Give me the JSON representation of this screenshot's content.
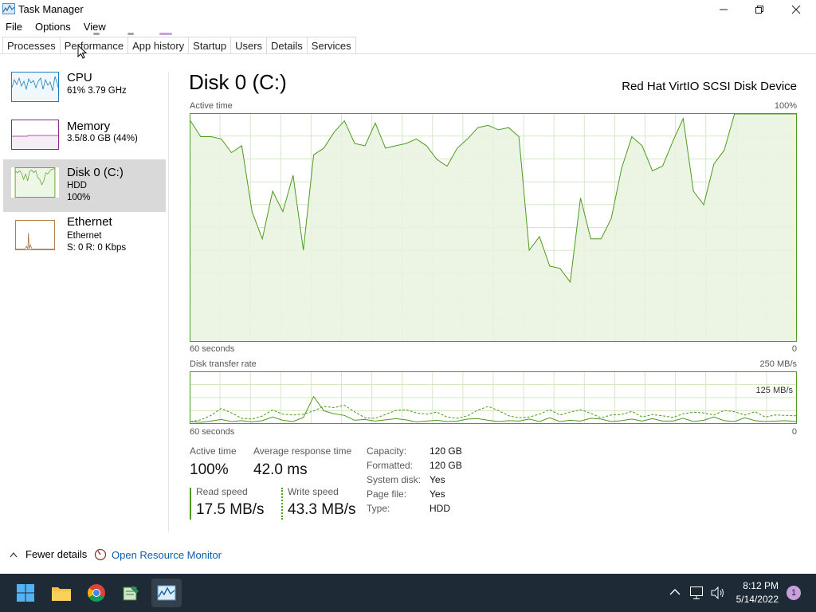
{
  "window": {
    "title": "Task Manager"
  },
  "menu": [
    "File",
    "Options",
    "View"
  ],
  "tabs": [
    "Processes",
    "Performance",
    "App history",
    "Startup",
    "Users",
    "Details",
    "Services"
  ],
  "active_tab": "Performance",
  "sidebar": {
    "items": [
      {
        "name": "CPU",
        "line1": "61% 3.79 GHz",
        "line2": "",
        "color": "#1a7fbf"
      },
      {
        "name": "Memory",
        "line1": "3.5/8.0 GB (44%)",
        "line2": "",
        "color": "#8b2b8b"
      },
      {
        "name": "Disk 0 (C:)",
        "line1": "HDD",
        "line2": "100%",
        "color": "#4d9a1d"
      },
      {
        "name": "Ethernet",
        "line1": "Ethernet",
        "line2": "S: 0 R: 0 Kbps",
        "color": "#a35a1e"
      }
    ]
  },
  "main": {
    "title": "Disk 0 (C:)",
    "device": "Red Hat VirtIO SCSI Disk Device",
    "active_time_label": "Active time",
    "active_time_max": "100%",
    "x_label_left": "60 seconds",
    "x_label_right": "0",
    "transfer_label": "Disk transfer rate",
    "transfer_max": "250 MB/s",
    "transfer_mid": "125 MB/s",
    "x2_label_left": "60 seconds",
    "x2_label_right": "0"
  },
  "stats": {
    "active_time_label": "Active time",
    "active_time_value": "100%",
    "avg_response_label": "Average response time",
    "avg_response_value": "42.0 ms",
    "read_label": "Read speed",
    "read_value": "17.5 MB/s",
    "write_label": "Write speed",
    "write_value": "43.3 MB/s"
  },
  "properties": [
    {
      "label": "Capacity:",
      "value": "120 GB"
    },
    {
      "label": "Formatted:",
      "value": "120 GB"
    },
    {
      "label": "System disk:",
      "value": "Yes"
    },
    {
      "label": "Page file:",
      "value": "Yes"
    },
    {
      "label": "Type:",
      "value": "HDD"
    }
  ],
  "footer": {
    "fewer_details": "Fewer details",
    "open_resource_monitor": "Open Resource Monitor"
  },
  "taskbar": {
    "icons": [
      "start-icon",
      "file-explorer-icon",
      "chrome-icon",
      "notepad-icon",
      "task-manager-icon"
    ],
    "time": "8:12 PM",
    "date": "5/14/2022",
    "notification_count": "1"
  },
  "colors": {
    "disk_line": "#4d9a1d",
    "disk_fill": "#e9f3df",
    "grid": "#d5e8c6",
    "accent_link": "#0b5cad"
  },
  "chart_data": [
    {
      "type": "area",
      "title": "Active time",
      "ylabel": "Active time",
      "ylim": [
        0,
        100
      ],
      "xlim": [
        60,
        0
      ],
      "series": [
        {
          "values": [
            97,
            90,
            90,
            89,
            83,
            86,
            57,
            45,
            66,
            57,
            73,
            40,
            82,
            85,
            92,
            97,
            87,
            86,
            96,
            85,
            86,
            87,
            89,
            86,
            80,
            77,
            85,
            89,
            94,
            95,
            93,
            94,
            90,
            40,
            46,
            33,
            32,
            26,
            63,
            45,
            45,
            54,
            76,
            90,
            86,
            75,
            77,
            88,
            98,
            66,
            60,
            78,
            84,
            100,
            100,
            100,
            100,
            100,
            100,
            100
          ]
        }
      ]
    },
    {
      "type": "line",
      "title": "Disk transfer rate",
      "ylim": [
        0,
        250
      ],
      "xlim": [
        60,
        0
      ],
      "series": [
        {
          "values": [
            8,
            16,
            38,
            72,
            50,
            24,
            20,
            35,
            64,
            44,
            40,
            44,
            60,
            82,
            76,
            88,
            55,
            26,
            24,
            42,
            62,
            66,
            50,
            44,
            54,
            30,
            24,
            36,
            64,
            82,
            62,
            36,
            26,
            30,
            44,
            66,
            40,
            54,
            66,
            48,
            26,
            40,
            42,
            58,
            30,
            42,
            36,
            28,
            46,
            54,
            50,
            40,
            62,
            56,
            40,
            56,
            30,
            40,
            38,
            36
          ]
        },
        {
          "values": [
            8,
            4,
            10,
            18,
            8,
            12,
            6,
            12,
            30,
            14,
            8,
            28,
            130,
            60,
            46,
            38,
            14,
            18,
            10,
            16,
            22,
            16,
            6,
            10,
            14,
            8,
            10,
            20,
            22,
            14,
            8,
            12,
            10,
            20,
            8,
            26,
            8,
            14,
            10,
            24,
            20,
            8,
            12,
            20,
            10,
            22,
            10,
            10,
            24,
            8,
            14,
            30,
            12,
            8,
            26,
            12,
            8,
            10,
            12,
            8
          ]
        }
      ]
    }
  ]
}
